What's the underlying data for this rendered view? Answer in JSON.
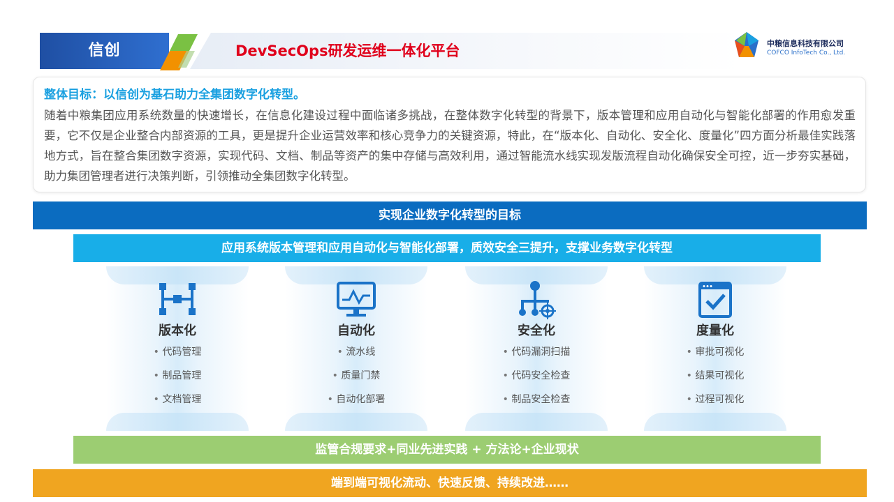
{
  "header": {
    "tag": "信创",
    "title": "DevSecOps研发运维一体化平台",
    "logo": {
      "name_cn": "中粮信息科技有限公司",
      "name_en": "COFCO InfoTech Co., Ltd."
    }
  },
  "summary": {
    "heading": "整体目标：以信创为基石助力全集团数字化转型。",
    "body": "随着中粮集团应用系统数量的快速增长，在信息化建设过程中面临诸多挑战，在整体数字化转型的背景下，版本管理和应用自动化与智能化部署的作用愈发重要，它不仅是企业整合内部资源的工具，更是提升企业运营效率和核心竞争力的关键资源，特此，在“版本化、自动化、安全化、度量化”四方面分析最佳实践落地方式，旨在整合集团数字资源，实现代码、文档、制品等资产的集中存储与高效利用，通过智能流水线实现发版流程自动化确保安全可控，近一步夯实基础，助力集团管理者进行决策判断，引领推动全集团数字化转型。"
  },
  "bars": {
    "goal": "实现企业数字化转型的目标",
    "app": "应用系统版本管理和应用自动化与智能化部署，质效安全三提升，支撑业务数字化转型",
    "regulation": "监管合规要求+同业先进实践 + 方法论+企业现状",
    "loop": "端到端可视化流动、快速反馈、持续改进……"
  },
  "pillars": [
    {
      "title": "版本化",
      "icon": "version-network-icon",
      "items": [
        "代码管理",
        "制品管理",
        "文档管理"
      ]
    },
    {
      "title": "自动化",
      "icon": "monitor-chart-icon",
      "items": [
        "流水线",
        "质量门禁",
        "自动化部署"
      ]
    },
    {
      "title": "安全化",
      "icon": "security-target-icon",
      "items": [
        "代码漏洞扫描",
        "代码安全检查",
        "制品安全检查"
      ]
    },
    {
      "title": "度量化",
      "icon": "checklist-icon",
      "items": [
        "审批可视化",
        "结果可视化",
        "过程可视化"
      ]
    }
  ],
  "colors": {
    "accent_red": "#e0001b",
    "header_blue": "#1f4fa3",
    "goal_bar": "#0b6cc0",
    "app_bar": "#18aee8",
    "regulation_bar": "#9ccd72",
    "loop_bar": "#f0a520",
    "icon_blue": "#1a73c8"
  }
}
